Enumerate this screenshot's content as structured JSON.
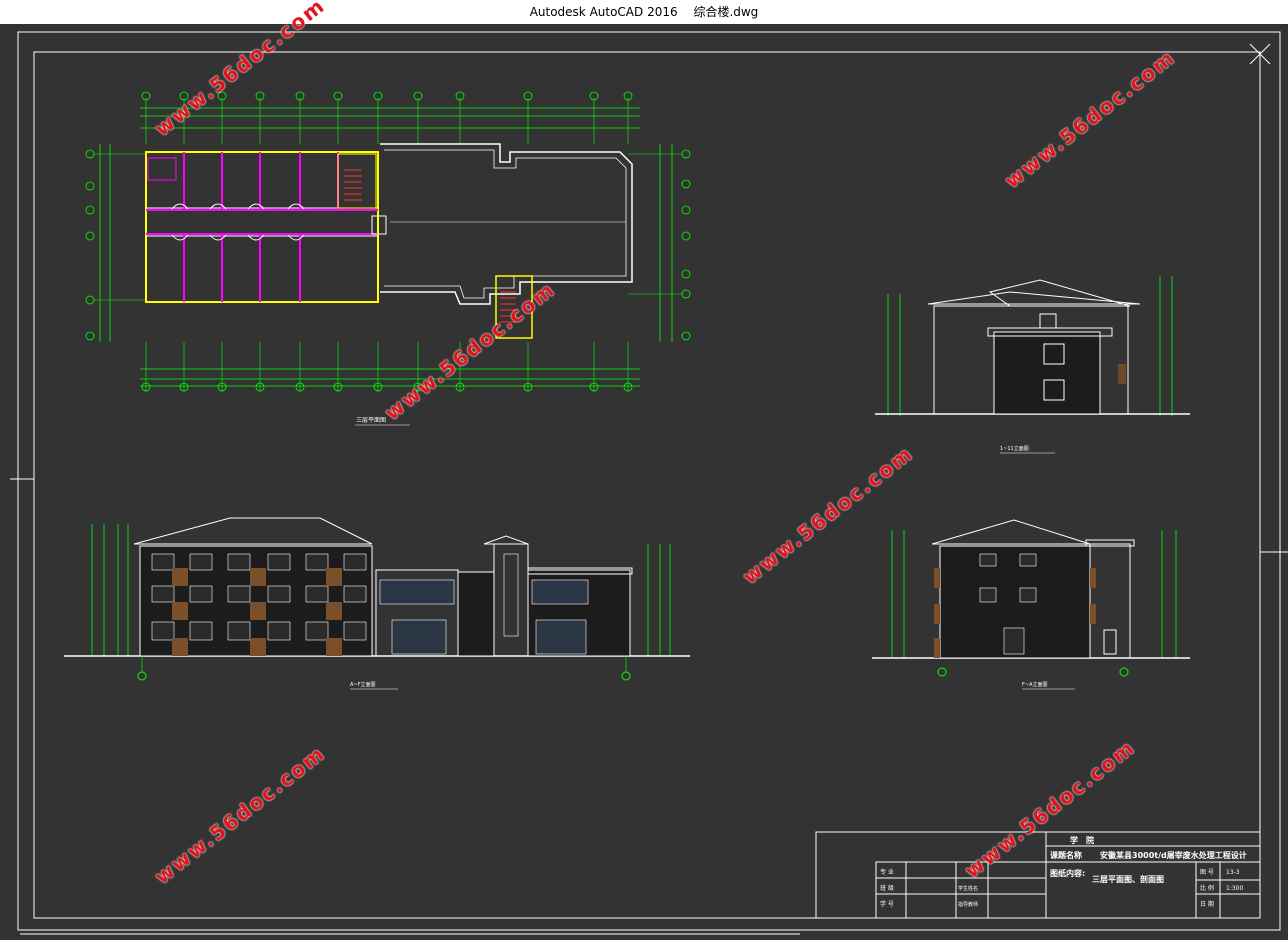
{
  "window": {
    "app": "Autodesk AutoCAD 2016",
    "file": "综合楼.dwg"
  },
  "watermark": "www.56doc.com",
  "colors": {
    "background": "#333333",
    "line": "#ffffff",
    "dimension": "#00ff00",
    "wall": "#ffff00",
    "partition": "#ff00ff",
    "stair": "#ff3333",
    "watermark": "#e0141c"
  },
  "drawing": {
    "plan_label": "三层平面图",
    "elev1_label": "1~11立面图",
    "elev2_label": "A~F立面图",
    "elev3_label": "F~A立面图"
  },
  "title_block": {
    "school": "学　院",
    "project_label": "课题名称",
    "project": "安徽某县3000t/d屠宰废水处理工程设计",
    "content_label": "图纸内容:",
    "content": "三层平面图、剖面图",
    "left_rows": [
      "专 业",
      "班 级",
      "学 号"
    ],
    "mid_rows": [
      "学生姓名",
      "指导教师"
    ],
    "right_labels": [
      "图 号",
      "比 例",
      "日 期"
    ],
    "right_values": [
      "13-3",
      "1:300",
      ""
    ]
  }
}
